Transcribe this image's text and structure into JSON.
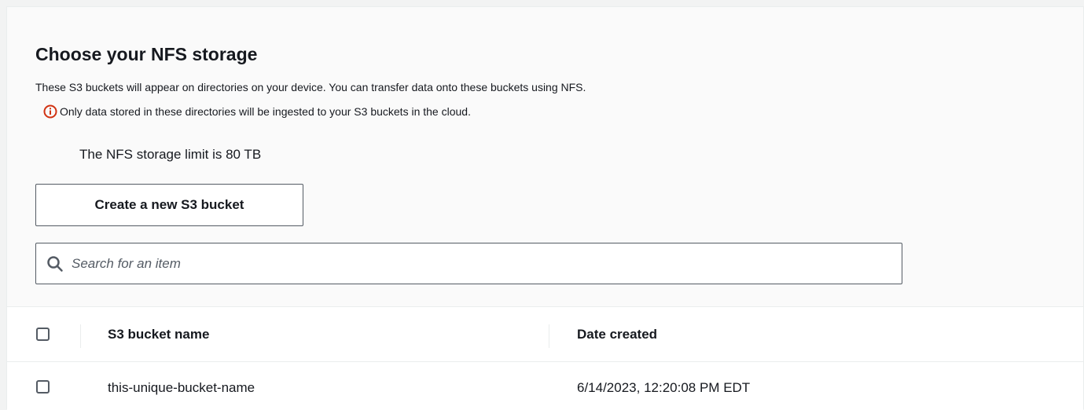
{
  "section": {
    "title": "Choose your NFS storage",
    "description": "These S3 buckets will appear on directories on your device. You can transfer data onto these buckets using NFS.",
    "warning": "Only data stored in these directories will be ingested to your S3 buckets in the cloud.",
    "storage_limit": "The NFS storage limit is 80 TB",
    "create_button_label": "Create a new S3 bucket"
  },
  "search": {
    "placeholder": "Search for an item"
  },
  "table": {
    "columns": [
      "S3 bucket name",
      "Date created"
    ],
    "rows": [
      {
        "name": "this-unique-bucket-name",
        "date": "6/14/2023, 12:20:08 PM EDT"
      }
    ]
  },
  "icons": {
    "warning": "info-circle-icon",
    "search": "search-icon"
  },
  "colors": {
    "warning_icon": "#d13212",
    "border": "#545b64",
    "divider": "#eaeded"
  }
}
